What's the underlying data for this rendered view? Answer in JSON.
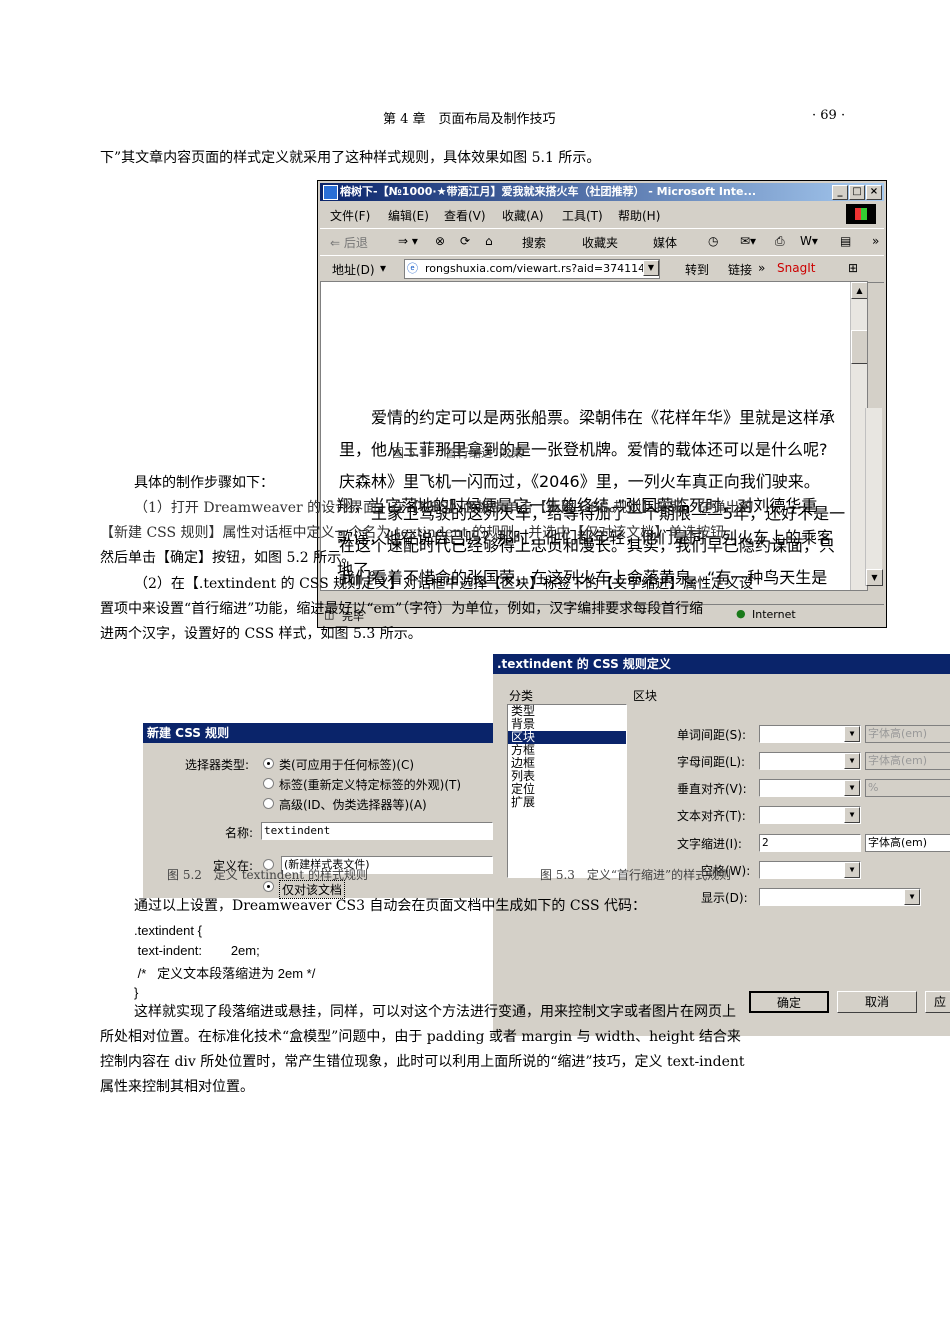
{
  "header": {
    "chapter": "第 4 章　页面布局及制作技巧",
    "page_number": "· 69 ·"
  },
  "paragraphs": {
    "intro": "下”其文章内容页面的样式定义就采用了这种样式规则，具体效果如图 5.1 所示。",
    "steps_heading": "具体的制作步骤如下：",
    "step1_line1": "（1）打开 Dreamweaver 的设计界面，在【CSS】面板中单击【新建 CSS 规则】按钮，在弹出的",
    "step1_line2": "【新建 CSS 规则】属性对话框中定义一个名为 textindent 的规则，并选中【仅对该文档】单选按钮，",
    "step1_line3": "然后单击【确定】按钮，如图 5.2 所示。",
    "step2_line1": "（2）在【.textindent 的 CSS 规则定义】对话框中选择【区块】标签下的【文字缩进】属性定义设",
    "step2_line2": "置项中来设置“首行缩进”功能，缩进最好以“em”（字符）为单位，例如，汉字编排要求每段首行缩",
    "step2_line3": "进两个汉字，设置好的 CSS 样式，如图 5.3 所示。",
    "after_settings": "通过以上设置，Dreamweaver CS3 自动会在页面文档中生成如下的 CSS 代码：",
    "closing_line1": "这样就实现了段落缩进或悬挂，同样，可以对这个方法进行变通，用来控制文字或者图片在网页上",
    "closing_line2": "所处相对位置。在标准化技术“盒模型”问题中，由于 padding 或者 margin 与 width、height 结合来",
    "closing_line3": "控制内容在 div 所处位置时，常产生错位现象，此时可以利用上面所说的“缩进”技巧，定义 text-indent",
    "closing_line4": "属性来控制其相对位置。"
  },
  "code": {
    "line1": ".textindent {",
    "line2": " text-indent:        2em;",
    "line3": " /*   定义文本段落缩进为 2em */",
    "line4": "}"
  },
  "captions": {
    "fig51": "图 5.1　“首行缩进”效果",
    "fig52": "图 5.2　定义 textindent 的样式规则",
    "fig53": "图 5.3　定义“首行缩进”的样式规则"
  },
  "browser": {
    "title": "榕树下-【№1000·★带酒江月】爱我就来搭火车（社团推荐） - Microsoft Inte...",
    "menu": [
      "文件(F)",
      "编辑(E)",
      "查看(V)",
      "收藏(A)",
      "工具(T)",
      "帮助(H)"
    ],
    "toolbar": {
      "back": "⇐ 后退",
      "search": "搜索",
      "favorites": "收藏夹",
      "media": "媒体"
    },
    "address_label": "地址(D)",
    "address_value": "rongshuxia.com/viewart.rs?aid=3741147",
    "go": "转到",
    "links": "链接",
    "snagit": "SnagIt",
    "content_lines": [
      "爱情的约定可以是两张船票。梁朝伟在《花样年华》里就是这样承",
      "里，他从王菲那里拿到的是一张登机牌。爱情的载体还可以是什么呢?",
      "庆森林》里飞机一闪而过，《2046》里，一列火车真正向我们驶来。",
      "王家卫驾驶的这列火车，给等待加了一个期限——5年，还好不是一",
      "在这个速配时代已经够得上忠贞和漫长。其实，我们早已隐约谋面，只",
      "我们看着不惜命的张国荣，在这列火车上命落黄泉。“有一种鸟天生是",
      "翔，当它落地的时候便是它一生的终结。”张国荣临死时，对刘德华重",
      "歌谣，他在说自己吗？那时，他们都年轻，他们是同一列火车上的乘客",
      "地了。"
    ],
    "status_done": "完毕",
    "status_zone": "Internet"
  },
  "dialog_new_rule": {
    "title": "新建 CSS 规则",
    "selector_type_label": "选择器类型:",
    "option_class": "类(可应用于任何标签)(C)",
    "option_tag": "标签(重新定义特定标签的外观)(T)",
    "option_advanced": "高级(ID、伪类选择器等)(A)",
    "name_label": "名称:",
    "name_value": "textindent",
    "define_in_label": "定义在:",
    "new_stylesheet": "(新建样式表文件)",
    "this_doc_only": "仅对该文档"
  },
  "dialog_rule_def": {
    "title": ".textindent 的 CSS 规则定义",
    "category_label": "分类",
    "section_label": "区块",
    "categories": [
      "类型",
      "背景",
      "区块",
      "方框",
      "边框",
      "列表",
      "定位",
      "扩展"
    ],
    "selected_category": "区块",
    "fields": {
      "word_spacing": "单词间距(S):",
      "letter_spacing": "字母间距(L):",
      "vertical_align": "垂直对齐(V):",
      "text_align": "文本对齐(T):",
      "text_indent": "文字缩进(I):",
      "whitespace": "空格(W):",
      "display": "显示(D):"
    },
    "unit_em": "字体高(em)",
    "unit_percent": "%",
    "text_indent_value": "2",
    "ok_button": "确定",
    "cancel_button": "取消",
    "apply_button": "应"
  }
}
